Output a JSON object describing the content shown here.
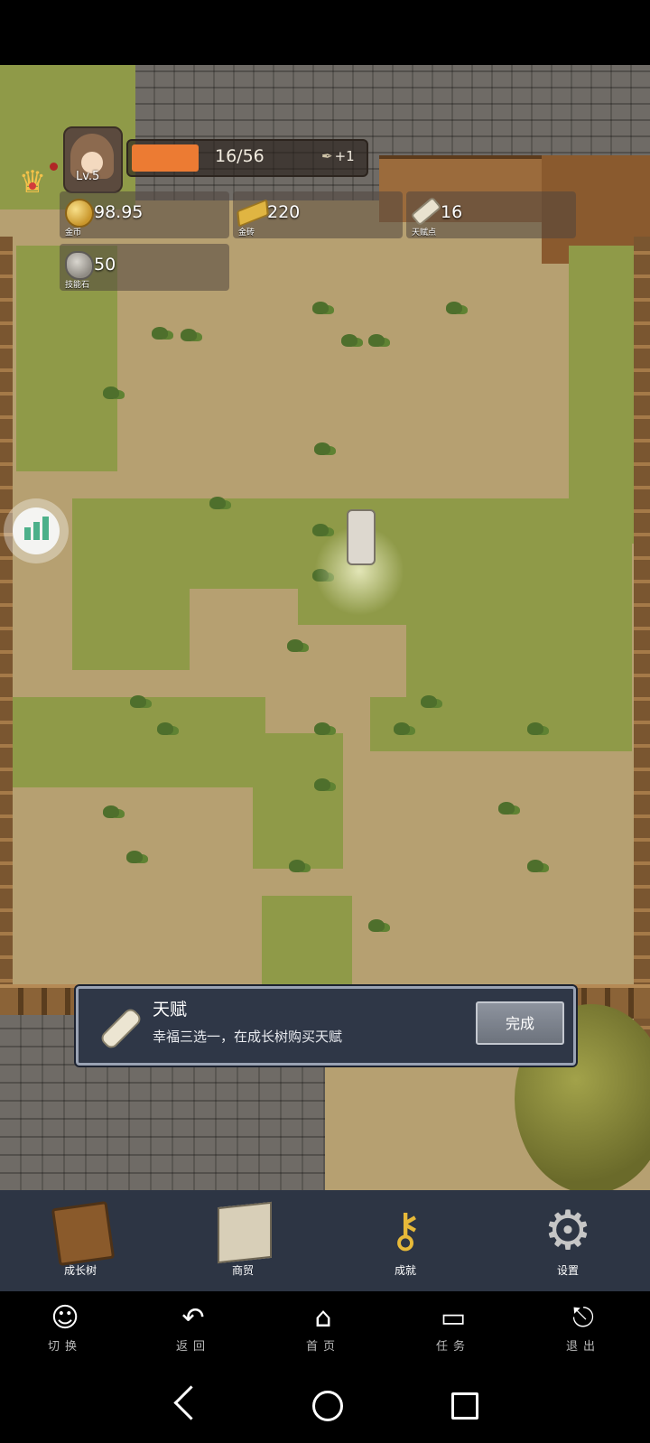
{
  "player": {
    "level": "Lv.5",
    "exp_text": "16/56",
    "exp_progress": 0.29,
    "exp_bonus": "+1"
  },
  "resources": [
    {
      "value": "98.95",
      "label": "金币",
      "icon": "gold-coin-icon"
    },
    {
      "value": "220",
      "label": "金砖",
      "icon": "gold-bar-icon"
    },
    {
      "value": "16",
      "label": "天赋点",
      "icon": "talent-scroll-icon"
    },
    {
      "value": "50",
      "label": "技能石",
      "icon": "skill-stone-icon"
    }
  ],
  "quest": {
    "title": "天赋",
    "description": "幸福三选一，在成长树购买天赋",
    "button": "完成"
  },
  "menu": [
    {
      "label": "成长树",
      "icon": "book-icon"
    },
    {
      "label": "商贸",
      "icon": "map-icon"
    },
    {
      "label": "成就",
      "icon": "key-icon"
    },
    {
      "label": "设置",
      "icon": "gear-icon"
    }
  ],
  "nav": [
    {
      "label": "切换",
      "icon": "switch-icon"
    },
    {
      "label": "返回",
      "icon": "return-icon"
    },
    {
      "label": "首页",
      "icon": "home-icon"
    },
    {
      "label": "任务",
      "icon": "task-icon"
    },
    {
      "label": "退出",
      "icon": "exit-icon"
    }
  ],
  "colors": {
    "exp_fill": "#ec7b33",
    "menu_bg": "#2d3544",
    "quest_bg": "#2f3747"
  }
}
